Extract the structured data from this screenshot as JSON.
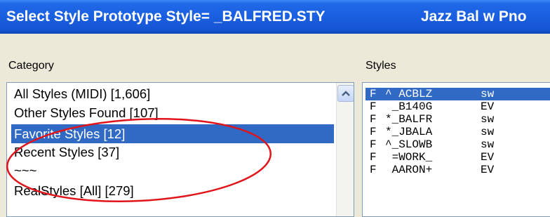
{
  "window": {
    "title": "Select Style Prototype Style= _BALFRED.STY",
    "title_right": "Jazz Bal w Pno"
  },
  "category": {
    "label": "Category",
    "items": [
      {
        "label": "All Styles (MIDI) [1,606]",
        "selected": false
      },
      {
        "label": "Other Styles Found [107]",
        "selected": false
      },
      {
        "label": "Favorite Styles [12]",
        "selected": true
      },
      {
        "label": "Recent Styles [37]",
        "selected": false
      },
      {
        "label": "~~~",
        "selected": false
      },
      {
        "label": "RealStyles [All] [279]",
        "selected": false
      }
    ]
  },
  "styles": {
    "label": "Styles",
    "rows": [
      {
        "flag": "F",
        "name": "^ ACBLZ",
        "type": "sw",
        "selected": true
      },
      {
        "flag": "F",
        "name": " _B140G",
        "type": "EV",
        "selected": false
      },
      {
        "flag": "F",
        "name": "*_BALFR",
        "type": "sw",
        "selected": false
      },
      {
        "flag": "F",
        "name": "*_JBALA",
        "type": "sw",
        "selected": false
      },
      {
        "flag": "F",
        "name": "^_SLOWB",
        "type": "sw",
        "selected": false
      },
      {
        "flag": "F",
        "name": " =WORK_",
        "type": "EV",
        "selected": false
      },
      {
        "flag": "F",
        "name": " AARON+",
        "type": "EV",
        "selected": false
      }
    ]
  },
  "annotation": {
    "color": "#e0141a"
  },
  "colors": {
    "titlebar": "#1a5fe0",
    "selection": "#316ac5"
  }
}
